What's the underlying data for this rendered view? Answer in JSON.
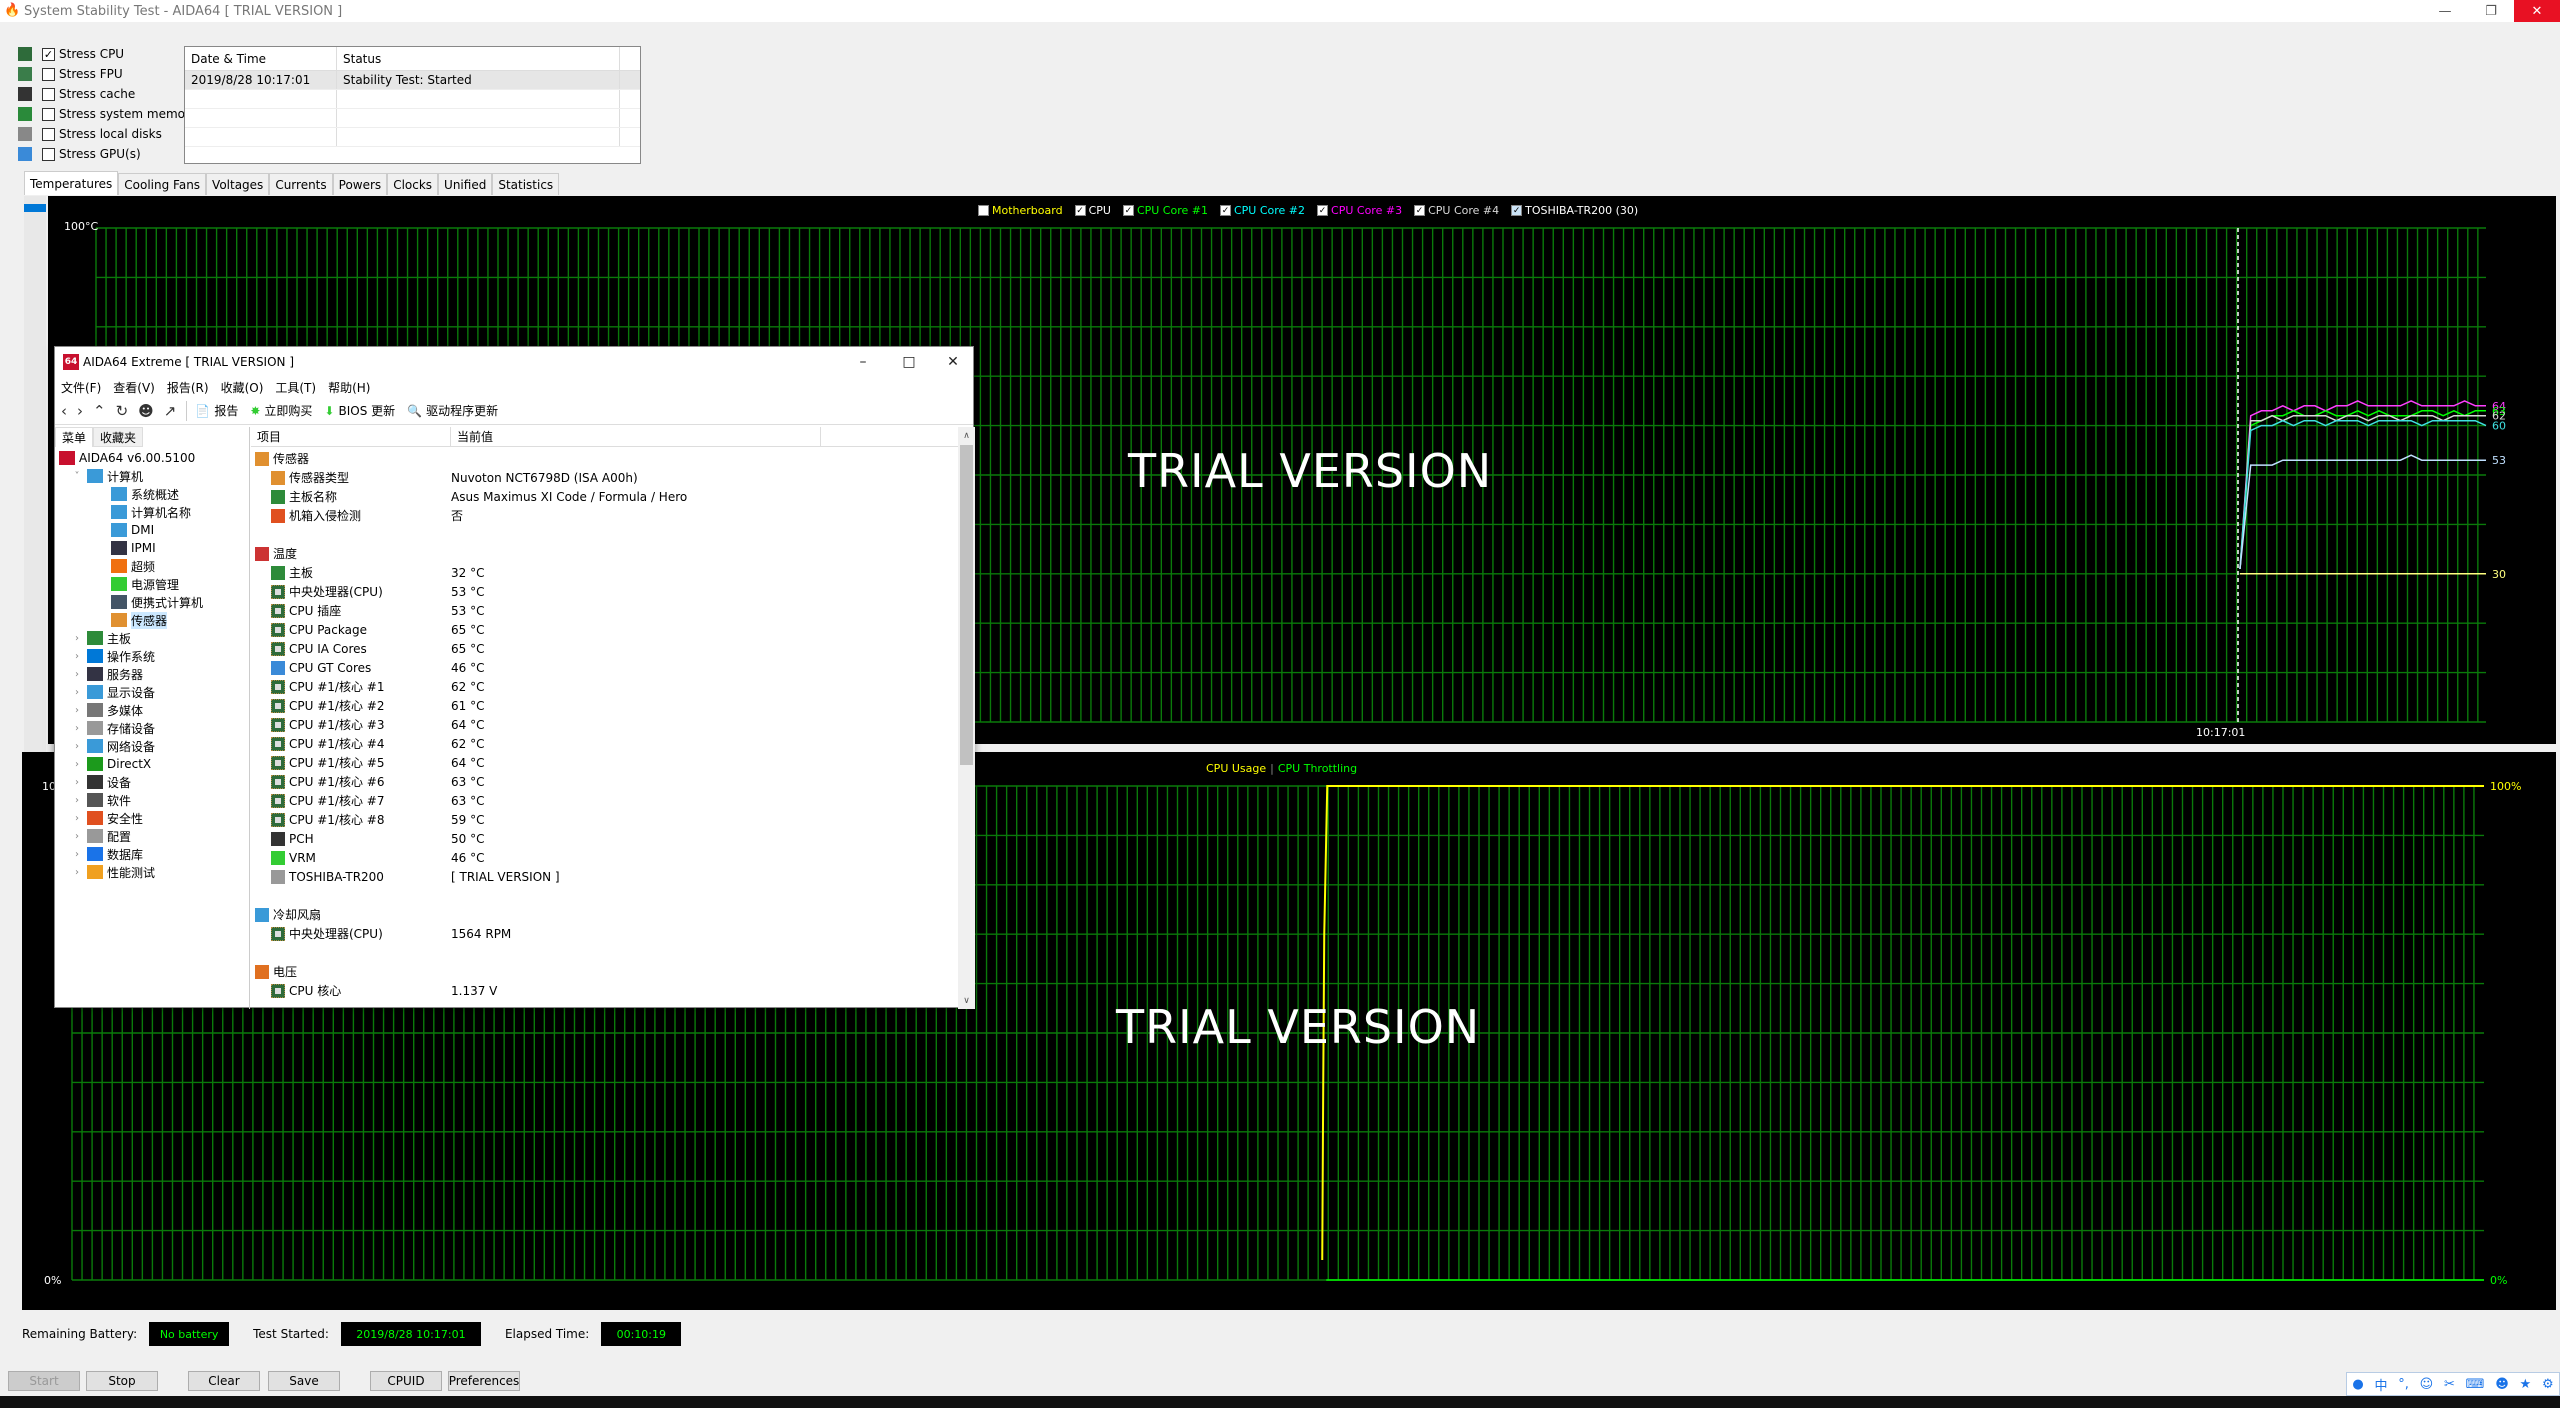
{
  "window": {
    "title": "System Stability Test - AIDA64  [ TRIAL VERSION ]",
    "controls": {
      "minimize": "—",
      "restore": "❐",
      "close": "✕"
    }
  },
  "stress_options": [
    {
      "label": "Stress CPU",
      "checked": true,
      "icon": "cpu-chip-icon"
    },
    {
      "label": "Stress FPU",
      "checked": false,
      "icon": "fpu-icon"
    },
    {
      "label": "Stress cache",
      "checked": false,
      "icon": "cache-chip-icon"
    },
    {
      "label": "Stress system memory",
      "checked": false,
      "icon": "memory-icon"
    },
    {
      "label": "Stress local disks",
      "checked": false,
      "icon": "disk-icon"
    },
    {
      "label": "Stress GPU(s)",
      "checked": false,
      "icon": "gpu-icon"
    }
  ],
  "log": {
    "headers": [
      "Date & Time",
      "Status"
    ],
    "rows": [
      [
        "2019/8/28 10:17:01",
        "Stability Test: Started"
      ]
    ]
  },
  "tabs": [
    "Temperatures",
    "Cooling Fans",
    "Voltages",
    "Currents",
    "Powers",
    "Clocks",
    "Unified",
    "Statistics"
  ],
  "active_tab": "Temperatures",
  "watermark": "TRIAL VERSION",
  "chart_data": [
    {
      "type": "line",
      "title": "Temperatures",
      "ylabel": "100°C",
      "ylim": [
        0,
        100
      ],
      "y_unit": "°C",
      "x_marker_label": "10:17:01",
      "grid": true,
      "legend": [
        {
          "name": "Motherboard",
          "checked": false,
          "color": "#ffff00"
        },
        {
          "name": "CPU",
          "checked": true,
          "color": "#ffffff"
        },
        {
          "name": "CPU Core #1",
          "checked": true,
          "color": "#00ff00"
        },
        {
          "name": "CPU Core #2",
          "checked": true,
          "color": "#00ffff"
        },
        {
          "name": "CPU Core #3",
          "checked": true,
          "color": "#ff00ff"
        },
        {
          "name": "CPU Core #4",
          "checked": true,
          "color": "#d8d8d8"
        },
        {
          "name": "TOSHIBA-TR200 (30)",
          "checked": true,
          "color": "#ffffff"
        }
      ],
      "series": [
        {
          "name": "CPU Core #3",
          "color": "#ff40ff",
          "current": 64,
          "values": [
            31,
            62,
            63,
            63,
            64,
            63,
            64,
            64,
            63,
            64,
            64,
            65,
            64,
            64,
            64,
            64,
            65,
            64,
            64,
            64,
            64,
            65,
            64,
            64
          ]
        },
        {
          "name": "CPU Core #1",
          "color": "#00ff00",
          "current": 63,
          "values": [
            31,
            60,
            61,
            62,
            62,
            63,
            62,
            62,
            63,
            62,
            62,
            63,
            62,
            63,
            62,
            62,
            62,
            63,
            63,
            62,
            63,
            62,
            63,
            63
          ]
        },
        {
          "name": "CPU Core #4",
          "color": "#d8d8d8",
          "current": 62,
          "values": [
            31,
            61,
            61,
            62,
            61,
            62,
            62,
            62,
            62,
            61,
            62,
            62,
            61,
            62,
            62,
            61,
            62,
            62,
            62,
            61,
            62,
            62,
            62,
            62
          ]
        },
        {
          "name": "CPU Core #2",
          "color": "#40e0e0",
          "current": 60,
          "values": [
            31,
            59,
            60,
            60,
            61,
            60,
            61,
            61,
            60,
            61,
            61,
            61,
            60,
            61,
            61,
            61,
            61,
            60,
            61,
            61,
            61,
            61,
            61,
            60
          ]
        },
        {
          "name": "CPU",
          "color": "#c0e0ff",
          "current": 53,
          "values": [
            31,
            52,
            52,
            52,
            53,
            53,
            53,
            53,
            53,
            53,
            53,
            53,
            53,
            53,
            53,
            53,
            54,
            53,
            53,
            53,
            53,
            53,
            53,
            53
          ]
        },
        {
          "name": "TOSHIBA-TR200",
          "color": "#ffff80",
          "current": 30,
          "values": [
            30,
            30,
            30,
            30,
            30,
            30,
            30,
            30,
            30,
            30,
            30,
            30,
            30,
            30,
            30,
            30,
            30,
            30,
            30,
            30,
            30,
            30,
            30,
            30
          ]
        }
      ]
    },
    {
      "type": "line",
      "title": "CPU Usage | CPU Throttling",
      "legend": [
        {
          "name": "CPU Usage",
          "color": "#ffff00"
        },
        {
          "name": "CPU Throttling",
          "color": "#00ff00"
        }
      ],
      "ylim": [
        0,
        100
      ],
      "y_top_label": "100%",
      "y_bottom_label": "0%",
      "left_axis_label": "10",
      "bottom_left_label": "0%",
      "grid": true,
      "series": [
        {
          "name": "CPU Usage",
          "color": "#ffff00",
          "start_fraction": 0.52,
          "values": [
            0,
            100,
            100,
            100,
            100,
            100,
            100,
            100,
            100,
            100,
            100,
            100
          ]
        },
        {
          "name": "CPU Throttling",
          "color": "#00ff00",
          "values": [
            0,
            0,
            0,
            0,
            0,
            0,
            0,
            0,
            0,
            0,
            0,
            0
          ]
        }
      ]
    }
  ],
  "status": {
    "battery_label": "Remaining Battery:",
    "battery_value": "No battery",
    "started_label": "Test Started:",
    "started_value": "2019/8/28 10:17:01",
    "elapsed_label": "Elapsed Time:",
    "elapsed_value": "00:10:19"
  },
  "buttons": {
    "start": "Start",
    "stop": "Stop",
    "clear": "Clear",
    "save": "Save",
    "cpuid": "CPUID",
    "preferences": "Preferences"
  },
  "ime_toolbar": [
    "user-icon",
    "中",
    "°,",
    "☺",
    "✂",
    "⌨",
    "☻",
    "★",
    "⚙"
  ],
  "aida": {
    "title": "AIDA64 Extreme  [ TRIAL VERSION ]",
    "logo": "64",
    "menu": [
      "文件(F)",
      "查看(V)",
      "报告(R)",
      "收藏(O)",
      "工具(T)",
      "帮助(H)"
    ],
    "toolbar": {
      "report": "报告",
      "buy": "立即购买",
      "bios": "BIOS 更新",
      "driver": "驱动程序更新"
    },
    "left_tabs": [
      "菜单",
      "收藏夹"
    ],
    "tree": [
      {
        "label": "AIDA64 v6.00.5100",
        "level": 0,
        "icon": "aida-logo-icon",
        "exp": ""
      },
      {
        "label": "计算机",
        "level": 1,
        "icon": "computer-icon",
        "exp": "˅"
      },
      {
        "label": "系统概述",
        "level": 2,
        "icon": "monitor-icon",
        "exp": ""
      },
      {
        "label": "计算机名称",
        "level": 2,
        "icon": "monitor-icon",
        "exp": ""
      },
      {
        "label": "DMI",
        "level": 2,
        "icon": "monitor-icon",
        "exp": ""
      },
      {
        "label": "IPMI",
        "level": 2,
        "icon": "server-icon",
        "exp": ""
      },
      {
        "label": "超频",
        "level": 2,
        "icon": "flame-icon",
        "exp": ""
      },
      {
        "label": "电源管理",
        "level": 2,
        "icon": "battery-icon",
        "exp": ""
      },
      {
        "label": "便携式计算机",
        "level": 2,
        "icon": "laptop-icon",
        "exp": ""
      },
      {
        "label": "传感器",
        "level": 2,
        "icon": "gauge-icon",
        "exp": "",
        "selected": true
      },
      {
        "label": "主板",
        "level": 1,
        "icon": "motherboard-icon",
        "exp": "›"
      },
      {
        "label": "操作系统",
        "level": 1,
        "icon": "windows-icon",
        "exp": "›"
      },
      {
        "label": "服务器",
        "level": 1,
        "icon": "server-icon",
        "exp": "›"
      },
      {
        "label": "显示设备",
        "level": 1,
        "icon": "display-icon",
        "exp": "›"
      },
      {
        "label": "多媒体",
        "level": 1,
        "icon": "speaker-icon",
        "exp": "›"
      },
      {
        "label": "存储设备",
        "level": 1,
        "icon": "storage-icon",
        "exp": "›"
      },
      {
        "label": "网络设备",
        "level": 1,
        "icon": "network-icon",
        "exp": "›"
      },
      {
        "label": "DirectX",
        "level": 1,
        "icon": "xbox-icon",
        "exp": "›"
      },
      {
        "label": "设备",
        "level": 1,
        "icon": "device-icon",
        "exp": "›"
      },
      {
        "label": "软件",
        "level": 1,
        "icon": "software-icon",
        "exp": "›"
      },
      {
        "label": "安全性",
        "level": 1,
        "icon": "shield-icon",
        "exp": "›"
      },
      {
        "label": "配置",
        "level": 1,
        "icon": "config-icon",
        "exp": "›"
      },
      {
        "label": "数据库",
        "level": 1,
        "icon": "database-icon",
        "exp": "›"
      },
      {
        "label": "性能测试",
        "level": 1,
        "icon": "benchmark-icon",
        "exp": "›"
      }
    ],
    "columns": [
      "项目",
      "当前值"
    ],
    "rows": [
      {
        "type": "group",
        "key": "传感器",
        "value": "",
        "icon": "gauge-icon"
      },
      {
        "type": "item",
        "key": "传感器类型",
        "value": "Nuvoton NCT6798D  (ISA A00h)",
        "icon": "gauge-icon"
      },
      {
        "type": "item",
        "key": "主板名称",
        "value": "Asus Maximus XI Code / Formula / Hero",
        "icon": "motherboard-icon"
      },
      {
        "type": "item",
        "key": "机箱入侵检测",
        "value": "否",
        "icon": "shield-icon"
      },
      {
        "type": "blank",
        "key": "",
        "value": ""
      },
      {
        "type": "group",
        "key": "温度",
        "value": "",
        "icon": "thermometer-icon"
      },
      {
        "type": "item",
        "key": "主板",
        "value": "32 °C",
        "icon": "motherboard-icon"
      },
      {
        "type": "item",
        "key": "中央处理器(CPU)",
        "value": "53 °C",
        "icon": "cpu-chip-icon"
      },
      {
        "type": "item",
        "key": "CPU 插座",
        "value": "53 °C",
        "icon": "cpu-chip-icon"
      },
      {
        "type": "item",
        "key": "CPU Package",
        "value": "65 °C",
        "icon": "cpu-chip-icon"
      },
      {
        "type": "item",
        "key": "CPU IA Cores",
        "value": "65 °C",
        "icon": "cpu-chip-icon"
      },
      {
        "type": "item",
        "key": "CPU GT Cores",
        "value": "46 °C",
        "icon": "gpu-icon"
      },
      {
        "type": "item",
        "key": "CPU #1/核心 #1",
        "value": "62 °C",
        "icon": "cpu-chip-icon"
      },
      {
        "type": "item",
        "key": "CPU #1/核心 #2",
        "value": "61 °C",
        "icon": "cpu-chip-icon"
      },
      {
        "type": "item",
        "key": "CPU #1/核心 #3",
        "value": "64 °C",
        "icon": "cpu-chip-icon"
      },
      {
        "type": "item",
        "key": "CPU #1/核心 #4",
        "value": "62 °C",
        "icon": "cpu-chip-icon"
      },
      {
        "type": "item",
        "key": "CPU #1/核心 #5",
        "value": "64 °C",
        "icon": "cpu-chip-icon"
      },
      {
        "type": "item",
        "key": "CPU #1/核心 #6",
        "value": "63 °C",
        "icon": "cpu-chip-icon"
      },
      {
        "type": "item",
        "key": "CPU #1/核心 #7",
        "value": "63 °C",
        "icon": "cpu-chip-icon"
      },
      {
        "type": "item",
        "key": "CPU #1/核心 #8",
        "value": "59 °C",
        "icon": "cpu-chip-icon"
      },
      {
        "type": "item",
        "key": "PCH",
        "value": "50 °C",
        "icon": "chip-icon"
      },
      {
        "type": "item",
        "key": "VRM",
        "value": "46 °C",
        "icon": "battery-icon"
      },
      {
        "type": "item",
        "key": "TOSHIBA-TR200",
        "value": "[ TRIAL VERSION ]",
        "icon": "disk-icon"
      },
      {
        "type": "blank",
        "key": "",
        "value": ""
      },
      {
        "type": "group",
        "key": "冷却风扇",
        "value": "",
        "icon": "fan-icon"
      },
      {
        "type": "item",
        "key": "中央处理器(CPU)",
        "value": "1564 RPM",
        "icon": "cpu-chip-icon"
      },
      {
        "type": "blank",
        "key": "",
        "value": ""
      },
      {
        "type": "group",
        "key": "电压",
        "value": "",
        "icon": "voltage-icon"
      },
      {
        "type": "item",
        "key": "CPU 核心",
        "value": "1.137 V",
        "icon": "cpu-chip-icon"
      }
    ]
  }
}
